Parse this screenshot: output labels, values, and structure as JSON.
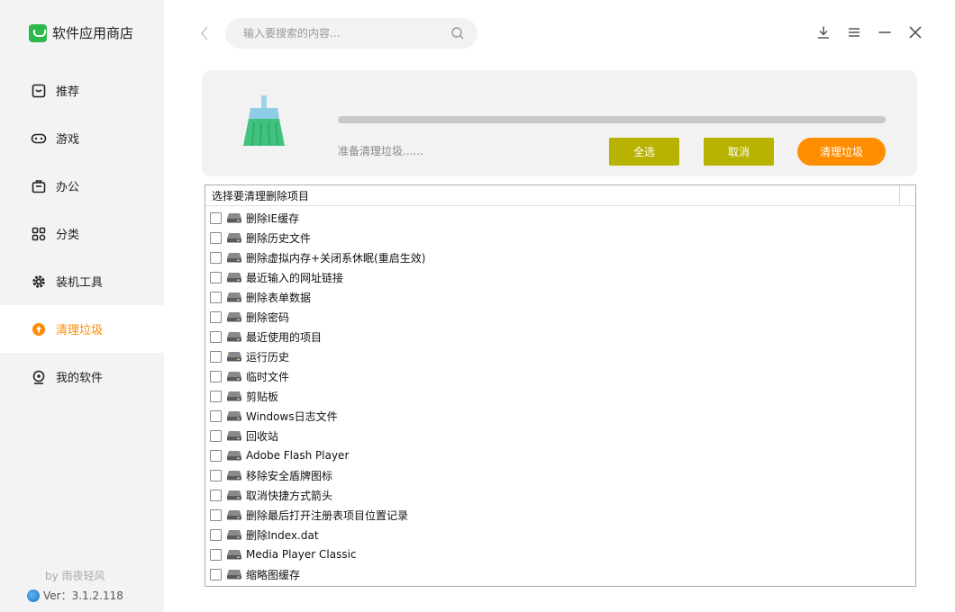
{
  "app": {
    "name": "软件应用商店",
    "credit": "by 雨夜轻风",
    "version": "Ver：3.1.2.118"
  },
  "sidebar": {
    "items": [
      {
        "label": "推荐",
        "icon": "recommend-icon"
      },
      {
        "label": "游戏",
        "icon": "gamepad-icon"
      },
      {
        "label": "办公",
        "icon": "briefcase-icon"
      },
      {
        "label": "分类",
        "icon": "category-icon"
      },
      {
        "label": "装机工具",
        "icon": "gear-icon"
      },
      {
        "label": "清理垃圾",
        "icon": "clean-icon",
        "active": true
      },
      {
        "label": "我的软件",
        "icon": "user-icon"
      }
    ]
  },
  "search": {
    "placeholder": "输入要搜索的内容..."
  },
  "clean": {
    "progress": 0,
    "status": "准备清理垃圾......",
    "select_all_label": "全选",
    "cancel_label": "取消",
    "clean_label": "清理垃圾"
  },
  "list": {
    "header": "选择要清理删除项目",
    "items": [
      "删除IE缓存",
      "删除历史文件",
      "删除虚拟内存+关闭系休眠(重启生效)",
      "最近输入的网址链接",
      "删除表单数据",
      "删除密码",
      "最近使用的项目",
      "运行历史",
      "临时文件",
      "剪贴板",
      "Windows日志文件",
      "回收站",
      "Adobe Flash Player",
      "移除安全盾牌图标",
      "取消快捷方式箭头",
      "删除最后打开注册表项目位置记录",
      "删除Index.dat",
      "Media Player Classic",
      "缩略图缓存"
    ]
  },
  "colors": {
    "accent": "#ff8c00",
    "olive_button": "#b7b300",
    "brand_green": "#2db84d"
  }
}
